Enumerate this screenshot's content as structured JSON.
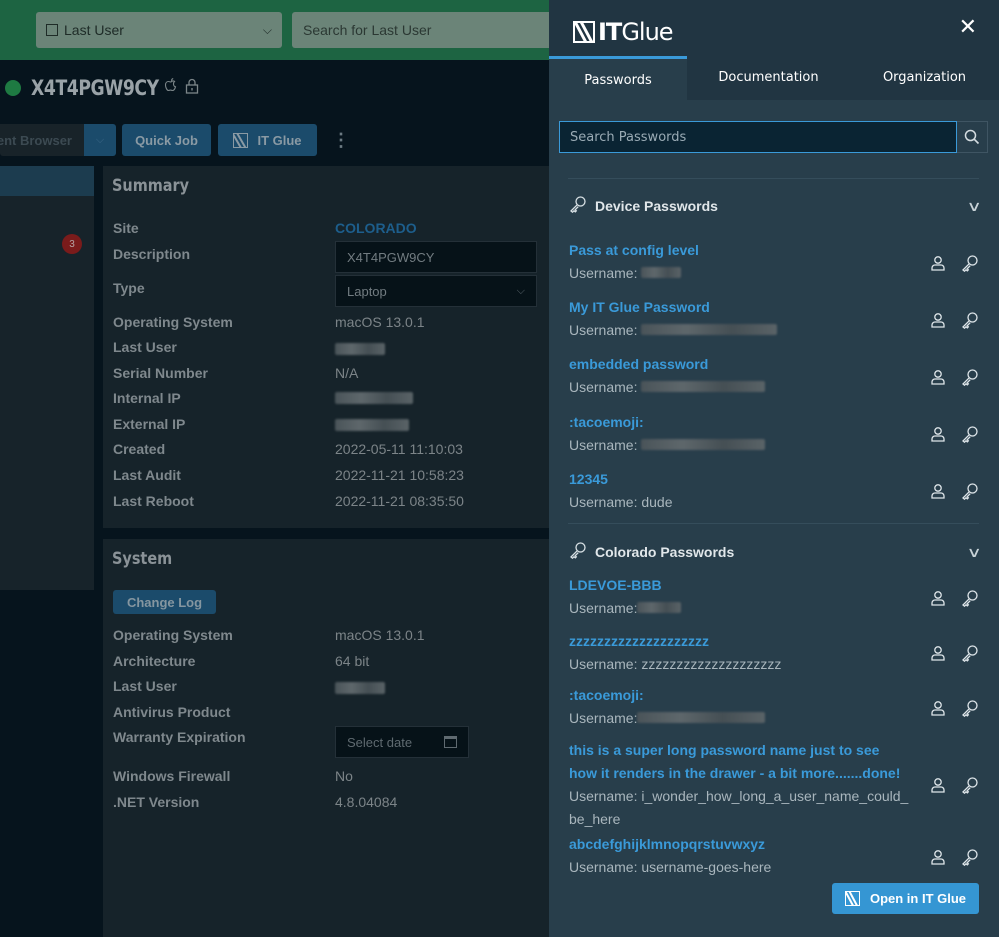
{
  "background_app": {
    "filter": {
      "selected": "Last User",
      "search_placeholder": "Search for Last User"
    },
    "device": {
      "name": "X4T4PGW9CY",
      "status": "online",
      "os_icon": "apple-icon",
      "lock_icon": "lock-icon"
    },
    "actions": {
      "agent_browser": "ent Browser",
      "quick_job": "Quick Job",
      "it_glue": "IT Glue",
      "more": "⋮"
    },
    "nav_badge": "3",
    "summary": {
      "title": "Summary",
      "rows": [
        {
          "label": "Site",
          "value": "COLORADO"
        },
        {
          "label": "Description",
          "value": "X4T4PGW9CY"
        },
        {
          "label": "Type",
          "value": "Laptop"
        },
        {
          "label": "Operating System",
          "value": "macOS 13.0.1"
        },
        {
          "label": "Last User",
          "value": ""
        },
        {
          "label": "Serial Number",
          "value": "N/A"
        },
        {
          "label": "Internal IP",
          "value": ""
        },
        {
          "label": "External IP",
          "value": ""
        },
        {
          "label": "Created",
          "value": "2022-05-11 11:10:03"
        },
        {
          "label": "Last Audit",
          "value": "2022-11-21 10:58:23"
        },
        {
          "label": "Last Reboot",
          "value": "2022-11-21 08:35:50"
        }
      ]
    },
    "system": {
      "title": "System",
      "change_log": "Change Log",
      "rows": [
        {
          "label": "Operating System",
          "value": "macOS 13.0.1"
        },
        {
          "label": "Architecture",
          "value": "64 bit"
        },
        {
          "label": "Last User",
          "value": ""
        },
        {
          "label": "Antivirus Product",
          "value": ""
        },
        {
          "label": "Warranty Expiration",
          "value": ""
        },
        {
          "label": "Windows Firewall",
          "value": "No"
        },
        {
          "label": ".NET Version",
          "value": "4.8.04084"
        }
      ],
      "date_placeholder": "Select date"
    }
  },
  "drawer": {
    "brand_it": "IT",
    "brand_glue": "Glue",
    "close": "✕",
    "tabs": [
      {
        "label": "Passwords",
        "active": true
      },
      {
        "label": "Documentation",
        "active": false
      },
      {
        "label": "Organization",
        "active": false
      }
    ],
    "search": {
      "placeholder": "Search Passwords",
      "value": ""
    },
    "groups": [
      {
        "title": "Device Passwords",
        "items": [
          {
            "name": "Pass at config level",
            "username_label": "Username:",
            "username": ""
          },
          {
            "name": "My IT Glue Password",
            "username_label": "Username:",
            "username": ""
          },
          {
            "name": "embedded password",
            "username_label": "Username:",
            "username": ""
          },
          {
            "name": ":tacoemoji:",
            "username_label": "Username:",
            "username": ""
          },
          {
            "name": "12345",
            "username_label": "Username:",
            "username": "dude"
          }
        ]
      },
      {
        "title": "Colorado Passwords",
        "items": [
          {
            "name": "LDEVOE-BBB",
            "username_label": "Username:",
            "username": ""
          },
          {
            "name": "zzzzzzzzzzzzzzzzzzzz",
            "username_label": "Username:",
            "username": "zzzzzzzzzzzzzzzzzzzz"
          },
          {
            "name": ":tacoemoji:",
            "username_label": "Username:",
            "username": ""
          },
          {
            "name": "this is a super long password name just to see how it renders in the drawer - a bit more.......done!",
            "username_label": "Username:",
            "username": "i_wonder_how_long_a_user_name_could_be_here"
          },
          {
            "name": "abcdefghijklmnopqrstuvwxyz",
            "username_label": "Username:",
            "username": "username-goes-here"
          }
        ]
      }
    ],
    "open_button": "Open in IT Glue",
    "accent_color": "#3a9ad9"
  }
}
